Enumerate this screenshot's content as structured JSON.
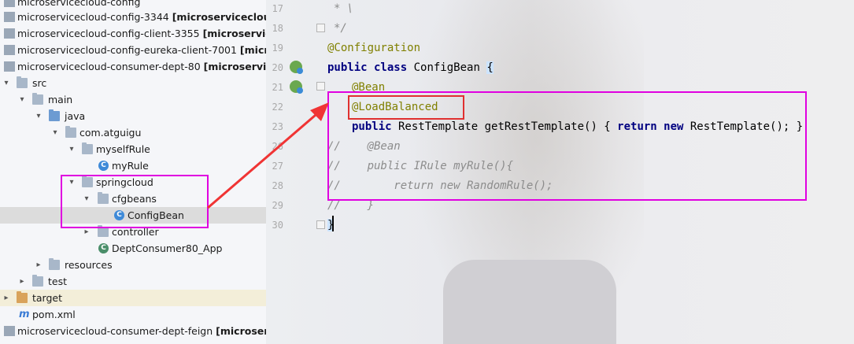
{
  "tree": {
    "items": [
      {
        "text": "microservicecloud-config",
        "bold": ""
      },
      {
        "text": "microservicecloud-config-3344 ",
        "bold": "[microservicecloudcon"
      },
      {
        "text": "microservicecloud-config-client-3355 ",
        "bold": "[microservicecl"
      },
      {
        "text": "microservicecloud-config-eureka-client-7001 ",
        "bold": "[microservic"
      },
      {
        "text": "microservicecloud-consumer-dept-80 ",
        "bold": "[microservicecl"
      },
      {
        "text": "src",
        "bold": ""
      },
      {
        "text": "main",
        "bold": ""
      },
      {
        "text": "java",
        "bold": ""
      },
      {
        "text": "com.atguigu",
        "bold": ""
      },
      {
        "text": "myselfRule",
        "bold": ""
      },
      {
        "text": "myRule",
        "bold": ""
      },
      {
        "text": "springcloud",
        "bold": ""
      },
      {
        "text": "cfgbeans",
        "bold": ""
      },
      {
        "text": "ConfigBean",
        "bold": ""
      },
      {
        "text": "controller",
        "bold": ""
      },
      {
        "text": "DeptConsumer80_App",
        "bold": ""
      },
      {
        "text": "resources",
        "bold": ""
      },
      {
        "text": "test",
        "bold": ""
      },
      {
        "text": "target",
        "bold": ""
      },
      {
        "text": "pom.xml",
        "bold": ""
      },
      {
        "text": "microservicecloud-consumer-dept-feign ",
        "bold": "[microservice"
      }
    ],
    "icons": {
      "class_letter": "C",
      "pom_letter": "m"
    }
  },
  "editor": {
    "line_numbers": [
      "17",
      "18",
      "19",
      "20",
      "21",
      "22",
      "23",
      "26",
      "27",
      "28",
      "29",
      "30"
    ],
    "lines": {
      "l17": "* \\",
      "l18": "*/",
      "l19_ann": "@Configuration",
      "l20_kw": "public class",
      "l20_rest": " ConfigBean ",
      "l20_brace": "{",
      "l21_ann": "@Bean",
      "l22_ann": "@LoadBalanced",
      "l23_kw1": "public",
      "l23_mid": " RestTemplate getRestTemplate() ",
      "l23_brace": "{",
      "l23_kw2": " return new",
      "l23_end": " RestTemplate(); }",
      "l26": "//    @Bean",
      "l27": "//    public IRule myRule(){",
      "l28": "//        return new RandomRule();",
      "l29": "//    }",
      "l30": "}"
    }
  },
  "colors": {
    "highlight_magenta": "#e000e0",
    "highlight_red": "#e03030",
    "arrow_red": "#f03434",
    "annotation": "#808000",
    "keyword": "#000080",
    "comment": "#8c8c8c"
  }
}
